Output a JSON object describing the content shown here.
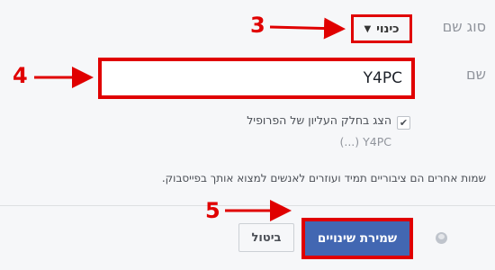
{
  "form": {
    "type_label": "סוג שם",
    "type_value": "כינוי",
    "name_label": "שם",
    "name_value": "Y4PC",
    "show_at_top_label": "הצג בחלק העליון של הפרופיל",
    "show_at_top_checked": true,
    "preview_text": "Y4PC (...)",
    "helper_text": "שמות אחרים הם ציבוריים תמיד ועוזרים לאנשים למצוא אותך בפייסבוק."
  },
  "actions": {
    "save_label": "שמירת שינויים",
    "cancel_label": "ביטול",
    "privacy_icon": "globe-icon"
  },
  "annotations": {
    "color": "#e00000",
    "labels": [
      "3",
      "4",
      "5"
    ]
  },
  "colors": {
    "save_button": "#4267b2",
    "highlight_border": "#e00000",
    "background": "#f6f7f9"
  }
}
